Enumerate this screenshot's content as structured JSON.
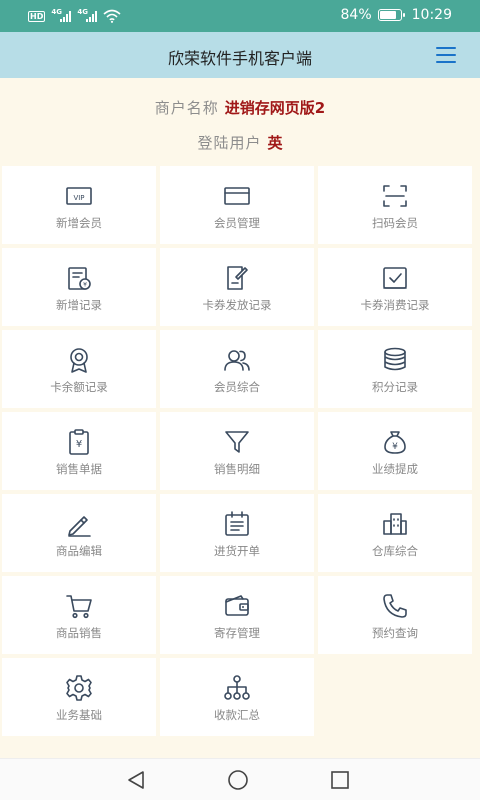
{
  "status": {
    "network": "HD",
    "signal_1": "4G",
    "signal_2": "4G",
    "battery_percent": "84%",
    "battery_level": 0.84,
    "time": "10:29"
  },
  "header": {
    "title": "欣荣软件手机客户端",
    "menu_icon": "hamburger-menu-icon"
  },
  "info": {
    "merchant_label": "商户名称",
    "merchant_value": "进销存网页版2",
    "user_label": "登陆用户",
    "user_value": "英"
  },
  "menu": [
    {
      "label": "新增会员",
      "icon": "vip-card-icon"
    },
    {
      "label": "会员管理",
      "icon": "card-icon"
    },
    {
      "label": "扫码会员",
      "icon": "scan-icon"
    },
    {
      "label": "新增记录",
      "icon": "receipt-icon"
    },
    {
      "label": "卡券发放记录",
      "icon": "document-edit-icon"
    },
    {
      "label": "卡券消费记录",
      "icon": "checkbox-icon"
    },
    {
      "label": "卡余额记录",
      "icon": "medal-icon"
    },
    {
      "label": "会员综合",
      "icon": "users-icon"
    },
    {
      "label": "积分记录",
      "icon": "coins-stack-icon"
    },
    {
      "label": "销售单据",
      "icon": "clipboard-yen-icon"
    },
    {
      "label": "销售明细",
      "icon": "filter-icon"
    },
    {
      "label": "业绩提成",
      "icon": "money-bag-icon"
    },
    {
      "label": "商品编辑",
      "icon": "pen-icon"
    },
    {
      "label": "进货开单",
      "icon": "calendar-list-icon"
    },
    {
      "label": "仓库综合",
      "icon": "warehouse-icon"
    },
    {
      "label": "商品销售",
      "icon": "cart-icon"
    },
    {
      "label": "寄存管理",
      "icon": "wallet-icon"
    },
    {
      "label": "预约查询",
      "icon": "phone-icon"
    },
    {
      "label": "业务基础",
      "icon": "gear-icon"
    },
    {
      "label": "收款汇总",
      "icon": "hierarchy-icon"
    }
  ],
  "colors": {
    "status_bar": "#4aa898",
    "header": "#b7dde7",
    "page_bg": "#fdf8ea",
    "icon": "#3a4a5e",
    "accent_value": "#a01818",
    "menu_button": "#1a73c9"
  },
  "navigation": {
    "back_icon": "back-triangle-icon",
    "home_icon": "home-circle-icon",
    "recents_icon": "recents-square-icon"
  }
}
